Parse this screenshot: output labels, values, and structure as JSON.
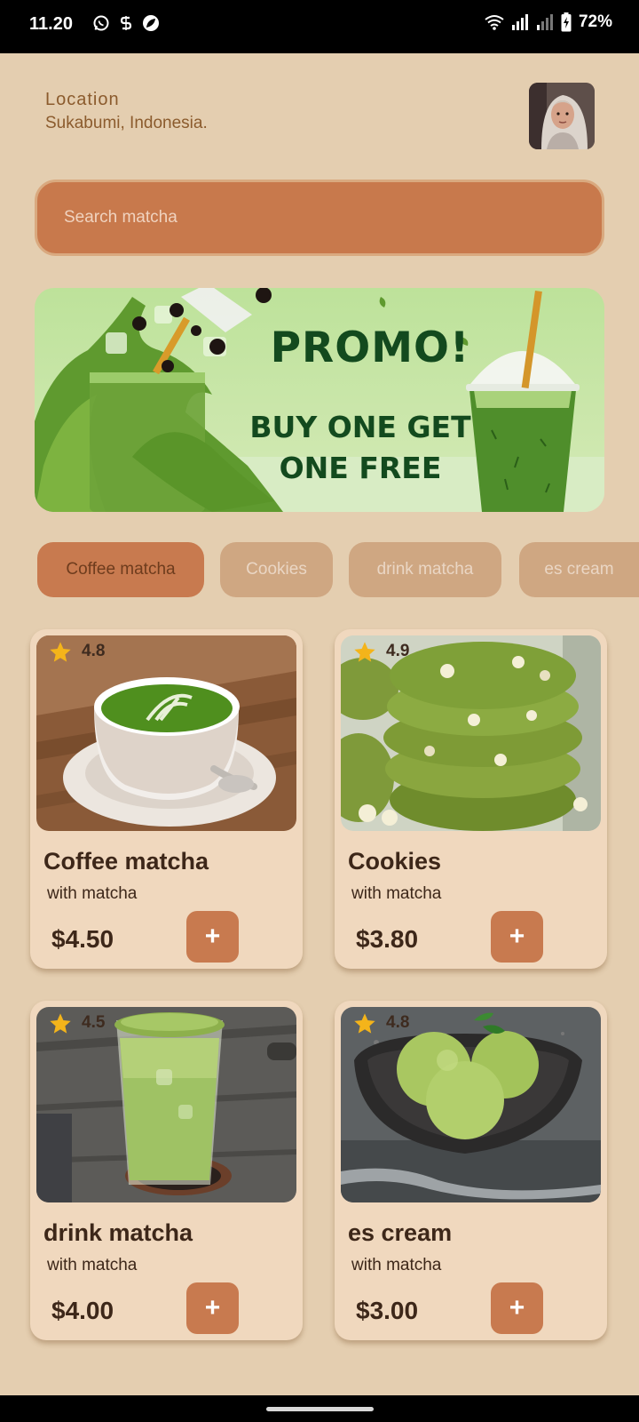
{
  "status": {
    "time": "11.20",
    "battery": "72%",
    "left_icons": [
      "whatsapp-icon",
      "s-app-icon",
      "leaf-app-icon"
    ],
    "right_icons": [
      "wifi-icon",
      "signal-icon",
      "signal-weak-icon",
      "battery-charging-icon"
    ]
  },
  "header": {
    "location_label": "Location",
    "location_value": "Sukabumi, Indonesia.",
    "avatar_icon": "profile-photo"
  },
  "search": {
    "placeholder": "Search matcha"
  },
  "banner": {
    "title": "PROMO!",
    "subtitle_line1": "BUY ONE GET",
    "subtitle_line2": "ONE FREE"
  },
  "categories": [
    {
      "label": "Coffee matcha",
      "active": true
    },
    {
      "label": "Cookies",
      "active": false
    },
    {
      "label": "drink matcha",
      "active": false
    },
    {
      "label": "es cream",
      "active": false
    }
  ],
  "products": [
    {
      "name": "Coffee matcha",
      "desc": "with matcha",
      "price": "$4.50",
      "rating": "4.8",
      "add": "+"
    },
    {
      "name": "Cookies",
      "desc": "with matcha",
      "price": "$3.80",
      "rating": "4.9",
      "add": "+"
    },
    {
      "name": "drink matcha",
      "desc": "with matcha",
      "price": "$4.00",
      "rating": "4.5",
      "add": "+"
    },
    {
      "name": "es cream",
      "desc": "with matcha",
      "price": "$3.00",
      "rating": "4.8",
      "add": "+"
    }
  ],
  "colors": {
    "background": "#e4ceb0",
    "accent": "#c87a4f",
    "chip_inactive": "#cfa782",
    "card": "#f0d8be",
    "promo_text": "#134a1e",
    "star": "#f4b41a"
  }
}
